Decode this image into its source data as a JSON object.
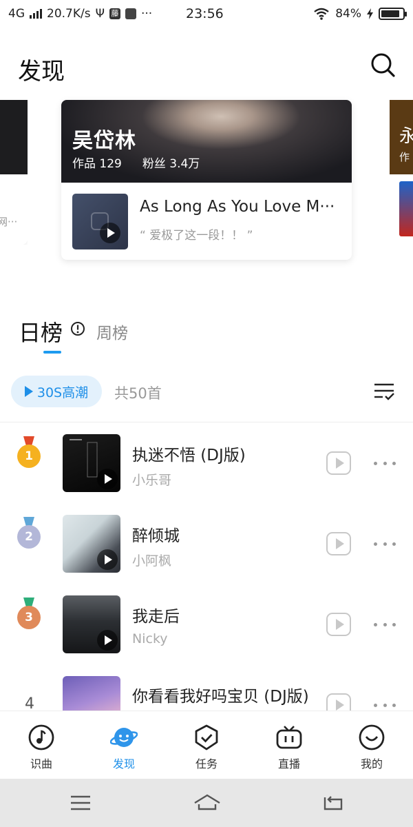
{
  "status_bar": {
    "network": "4G",
    "speed": "20.7K/s",
    "usb": "Ψ",
    "app_badge": "藤",
    "more": "···",
    "time": "23:56",
    "battery": "84%"
  },
  "header": {
    "title": "发现"
  },
  "carousel": {
    "prev_card_snippet": "网···",
    "next_card_name": "永",
    "next_card_stat": "作",
    "featured": {
      "artist_name": "吴岱林",
      "works": "作品 129",
      "fans": "粉丝 3.4万",
      "song_title": "As Long As You Love M···",
      "song_quote": "“ 爱极了这一段！！ ”"
    }
  },
  "chart_tabs": {
    "daily": "日榜",
    "weekly": "周榜"
  },
  "toolbar": {
    "highlight_label": "30S高潮",
    "total": "共50首"
  },
  "songs": [
    {
      "rank": "1",
      "title": "执迷不悟 (DJ版)",
      "artist": "小乐哥"
    },
    {
      "rank": "2",
      "title": "醉倾城",
      "artist": "小阿枫"
    },
    {
      "rank": "3",
      "title": "我走后",
      "artist": "Nicky"
    },
    {
      "rank": "4",
      "title": "你看看我好吗宝贝 (DJ版)",
      "artist": ""
    }
  ],
  "bottom_nav": [
    {
      "label": "识曲",
      "icon": "music-note-icon"
    },
    {
      "label": "发现",
      "icon": "planet-icon",
      "active": true
    },
    {
      "label": "任务",
      "icon": "shield-check-icon"
    },
    {
      "label": "直播",
      "icon": "tv-icon"
    },
    {
      "label": "我的",
      "icon": "smile-icon"
    }
  ],
  "colors": {
    "accent": "#1e8fe8",
    "gold_medal": "#f5b120",
    "silver_medal": "#b3b7d8",
    "bronze_medal": "#e08a5a"
  }
}
